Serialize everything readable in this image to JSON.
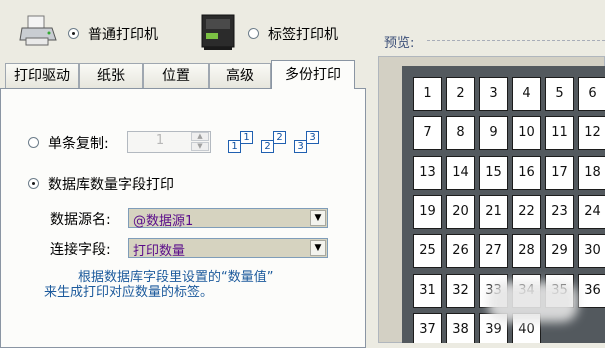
{
  "printers": {
    "normal_label": "普通打印机",
    "label_label": "标签打印机"
  },
  "tabs": [
    "打印驱动",
    "纸张",
    "位置",
    "高级",
    "多份打印"
  ],
  "multi_copy": {
    "single_copy_label": "单条复制:",
    "single_copy_value": "1",
    "copy_icon_numbers": [
      "1",
      "1",
      "2",
      "2",
      "3",
      "3"
    ],
    "db_field_label": "数据库数量字段打印",
    "datasource_label": "数据源名:",
    "datasource_value": "@数据源1",
    "link_field_label": "连接字段:",
    "link_field_value": "打印数量",
    "hint_line1": "根据数据库字段里设置的“数量值”",
    "hint_line2": "来生成打印对应数量的标签。"
  },
  "preview": {
    "label": "预览:",
    "cells": [
      "1",
      "2",
      "3",
      "4",
      "5",
      "6",
      "7",
      "8",
      "9",
      "10",
      "11",
      "12",
      "13",
      "14",
      "15",
      "16",
      "17",
      "18",
      "19",
      "20",
      "21",
      "22",
      "23",
      "24",
      "25",
      "26",
      "27",
      "28",
      "29",
      "30",
      "31",
      "32",
      "33",
      "34",
      "35",
      "36",
      "37",
      "38",
      "39",
      "40"
    ]
  },
  "colors": {
    "background": "#ecebe2",
    "hint_text": "#1c5a9c",
    "select_text": "#5a0c8a",
    "preview_dark": "#53595e"
  }
}
